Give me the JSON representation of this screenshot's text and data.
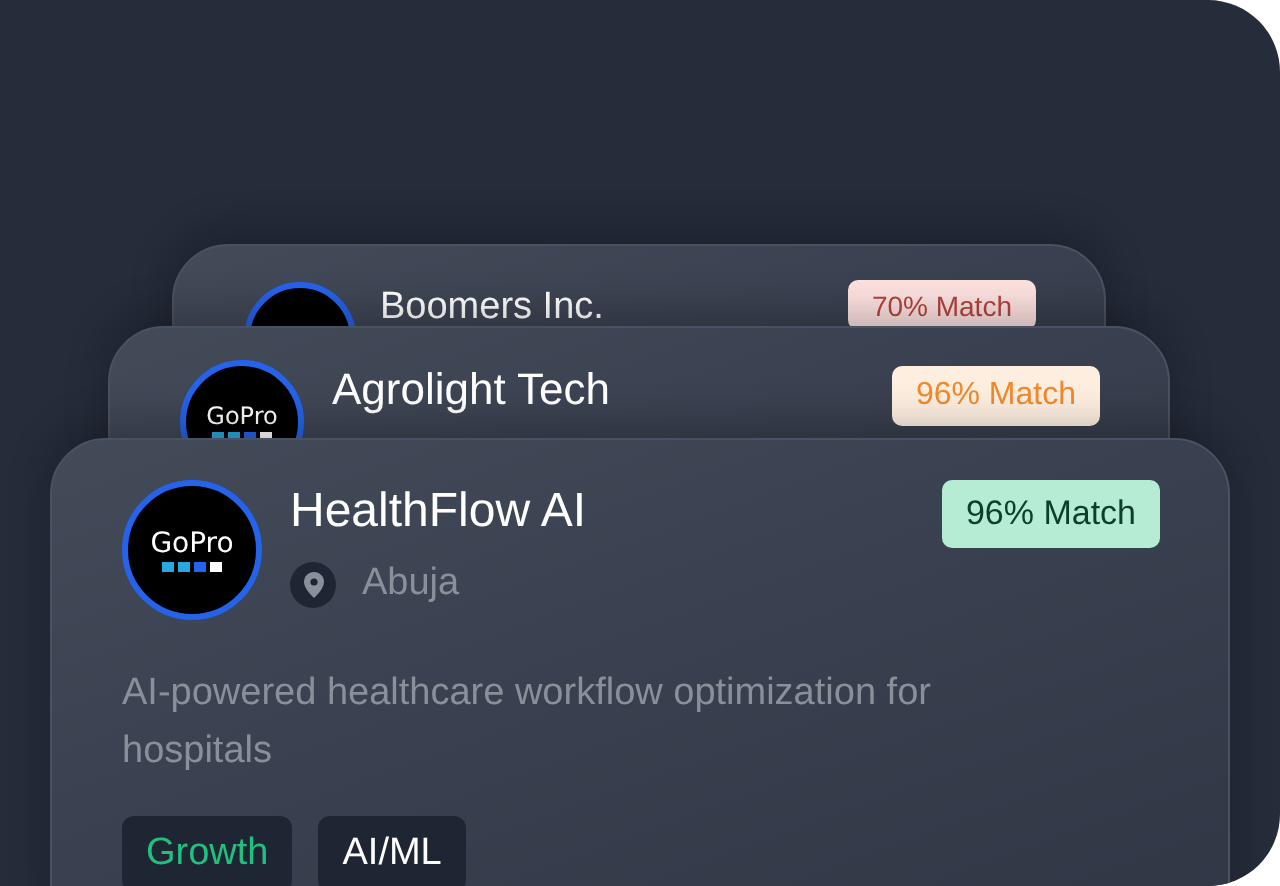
{
  "cards": [
    {
      "name": "Boomers Inc.",
      "match": "70% Match",
      "color": "#b4443f"
    },
    {
      "name": "Agrolight Tech",
      "logo_text": "GoPro",
      "match": "96% Match",
      "color": "#f08a2c"
    },
    {
      "name": "HealthFlow AI",
      "logo_text": "GoPro",
      "match": "96% Match",
      "color": "#0f3d2c",
      "location": "Abuja",
      "description": "AI-powered healthcare workflow optimization for hospitals",
      "tags": [
        {
          "label": "Growth",
          "color": "#22c07f"
        },
        {
          "label": "AI/ML",
          "color": "#ffffff"
        }
      ]
    }
  ]
}
